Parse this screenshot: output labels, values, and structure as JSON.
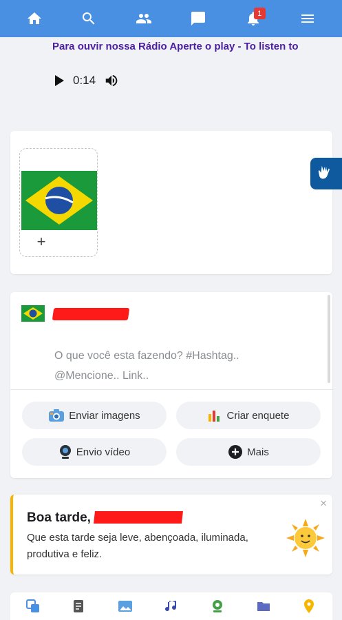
{
  "nav": {
    "icons": [
      "home-icon",
      "search-icon",
      "friends-icon",
      "messages-icon",
      "notifications-icon",
      "menu-icon"
    ],
    "notification_count": "1",
    "color": "#4a90e2"
  },
  "radio": {
    "title": "Para ouvir nossa Rádio Aperte o play - To listen to",
    "time": "0:14"
  },
  "composer": {
    "placeholder_line1": "O que você esta fazendo? #Hashtag..",
    "placeholder_line2": "@Mencione.. Link.."
  },
  "actions": {
    "images": "Enviar imagens",
    "poll": "Criar enquete",
    "video": "Envio vídeo",
    "more": "Mais"
  },
  "greeting": {
    "title": "Boa tarde,",
    "message": "Que esta tarde seja leve, abençoada, iluminada, produtiva e feliz.",
    "close": "×"
  },
  "bottom_tabs": [
    "posts-icon",
    "articles-icon",
    "photos-icon",
    "music-icon",
    "webcam-icon",
    "folder-icon",
    "location-icon"
  ]
}
